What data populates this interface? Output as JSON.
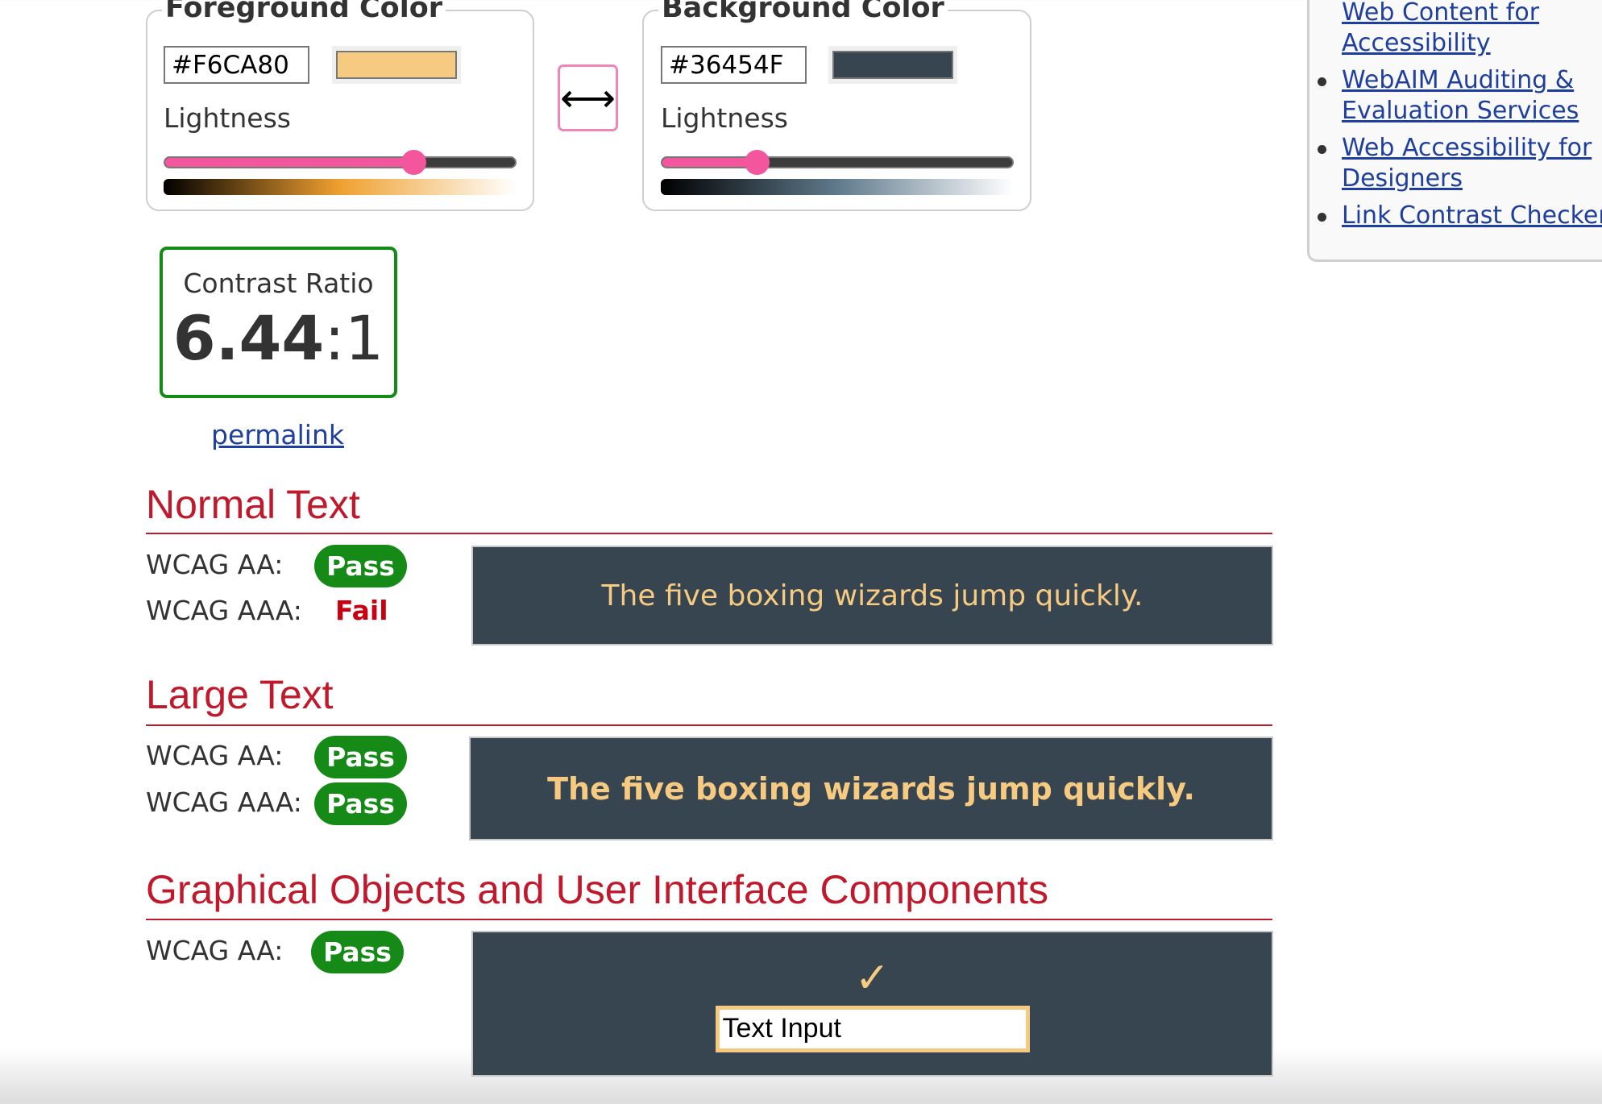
{
  "foreground": {
    "legend": "Foreground Color",
    "hex_value": "#F6CA80",
    "swatch_color": "#F6CA80",
    "lightness_label": "Lightness",
    "lightness_fraction": 0.71,
    "gradient": [
      "#000000",
      "#f0a030",
      "#ffffff"
    ]
  },
  "swap_button": {
    "icon": "left-right-arrow",
    "glyph": "⟷"
  },
  "background": {
    "legend": "Background Color",
    "hex_value": "#36454F",
    "swatch_color": "#36454F",
    "lightness_label": "Lightness",
    "lightness_fraction": 0.27,
    "gradient": [
      "#000000",
      "#5f7a8c",
      "#ffffff"
    ]
  },
  "sidebar": {
    "links": [
      {
        "label": "Quick Reference: Testing Web Content for Accessibility"
      },
      {
        "label": "WebAIM Auditing & Evaluation Services"
      },
      {
        "label": "Web Accessibility for Designers"
      },
      {
        "label": "Link Contrast Checker"
      }
    ]
  },
  "contrast": {
    "label": "Contrast Ratio",
    "ratio": "6.44",
    "suffix": ":1",
    "permalink": "permalink",
    "border_color": "#168a17"
  },
  "sections": {
    "normal": {
      "heading": "Normal Text",
      "aa_label": "WCAG AA:",
      "aa_result": "Pass",
      "aaa_label": "WCAG AAA:",
      "aaa_result": "Fail",
      "sample": "The five boxing wizards jump quickly."
    },
    "large": {
      "heading": "Large Text",
      "aa_label": "WCAG AA:",
      "aa_result": "Pass",
      "aaa_label": "WCAG AAA:",
      "aaa_result": "Pass",
      "sample": "The five boxing wizards jump quickly."
    },
    "graphical": {
      "heading": "Graphical Objects and User Interface Components",
      "aa_label": "WCAG AA:",
      "aa_result": "Pass",
      "check_glyph": "✓",
      "input_value": "Text Input"
    }
  },
  "colors": {
    "pass": "#168a17",
    "fail": "#c8000f",
    "heading": "#c0192c",
    "link": "#1e3f9e",
    "slider_accent": "#f4569d"
  }
}
